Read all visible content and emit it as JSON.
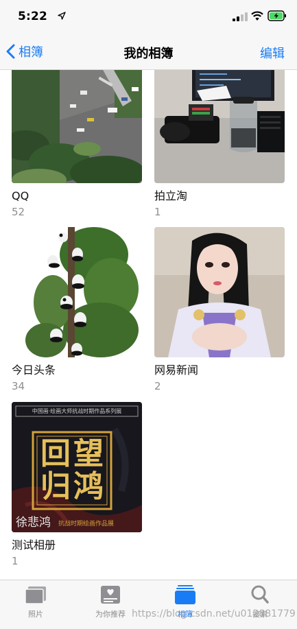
{
  "status_bar": {
    "time": "5:22",
    "icons": [
      "location-arrow-icon",
      "signal-bars-icon",
      "wifi-icon",
      "battery-charging-icon"
    ],
    "battery_color": "#4cd964"
  },
  "nav": {
    "back_label": "相簿",
    "title": "我的相簿",
    "edit_label": "编辑",
    "accent_color": "#1a7cf5"
  },
  "albums": [
    {
      "name": "QQ",
      "count": "52"
    },
    {
      "name": "拍立淘",
      "count": "1"
    },
    {
      "name": "今日头条",
      "count": "34"
    },
    {
      "name": "网易新闻",
      "count": "2"
    },
    {
      "name": "测试相册",
      "count": "1"
    }
  ],
  "poster": {
    "header_line": "中国画·绘画大师抗战时期作品系列展",
    "char1": "回",
    "char2": "望",
    "char3": "归",
    "char4": "鸿",
    "artist": "徐悲鸿",
    "subtitle": "抗战时期绘画作品展"
  },
  "tabs": [
    {
      "label": "照片",
      "icon": "photos-stack-icon",
      "active": false
    },
    {
      "label": "为你推荐",
      "icon": "for-you-icon",
      "active": false
    },
    {
      "label": "相簿",
      "icon": "albums-icon",
      "active": true
    },
    {
      "label": "搜索",
      "icon": "search-icon",
      "active": false
    }
  ],
  "watermark": "https://blog.csdn.net/u012881779"
}
